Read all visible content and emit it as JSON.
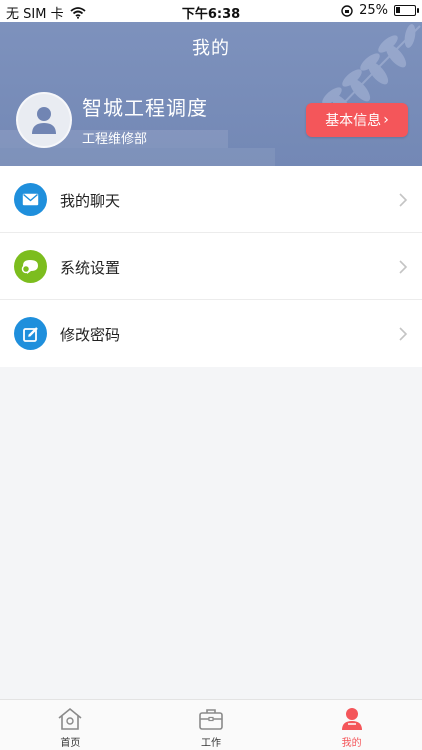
{
  "status_bar": {
    "carrier": "无 SIM 卡",
    "time": "下午6:38",
    "battery_text": "25%",
    "battery_level": 0.25
  },
  "header": {
    "title": "我的",
    "user_name": "智城工程调度",
    "department": "工程维修部",
    "info_button_label": "基本信息",
    "info_button_arrow": "›"
  },
  "menu": {
    "items": [
      {
        "label": "我的聊天",
        "icon": "mail-icon",
        "color": "#1f8fdc"
      },
      {
        "label": "系统设置",
        "icon": "chat-bubbles-icon",
        "color": "#7cbd1e"
      },
      {
        "label": "修改密码",
        "icon": "edit-icon",
        "color": "#1f8fdc"
      }
    ]
  },
  "tabbar": {
    "tabs": [
      {
        "label": "首页",
        "icon": "home-icon"
      },
      {
        "label": "工作",
        "icon": "briefcase-icon"
      },
      {
        "label": "我的",
        "icon": "profile-icon",
        "active": true
      }
    ]
  },
  "colors": {
    "header_bg": "#7a8eb9",
    "accent_red": "#f4565a",
    "blue": "#1f8fdc",
    "green": "#7cbd1e"
  }
}
